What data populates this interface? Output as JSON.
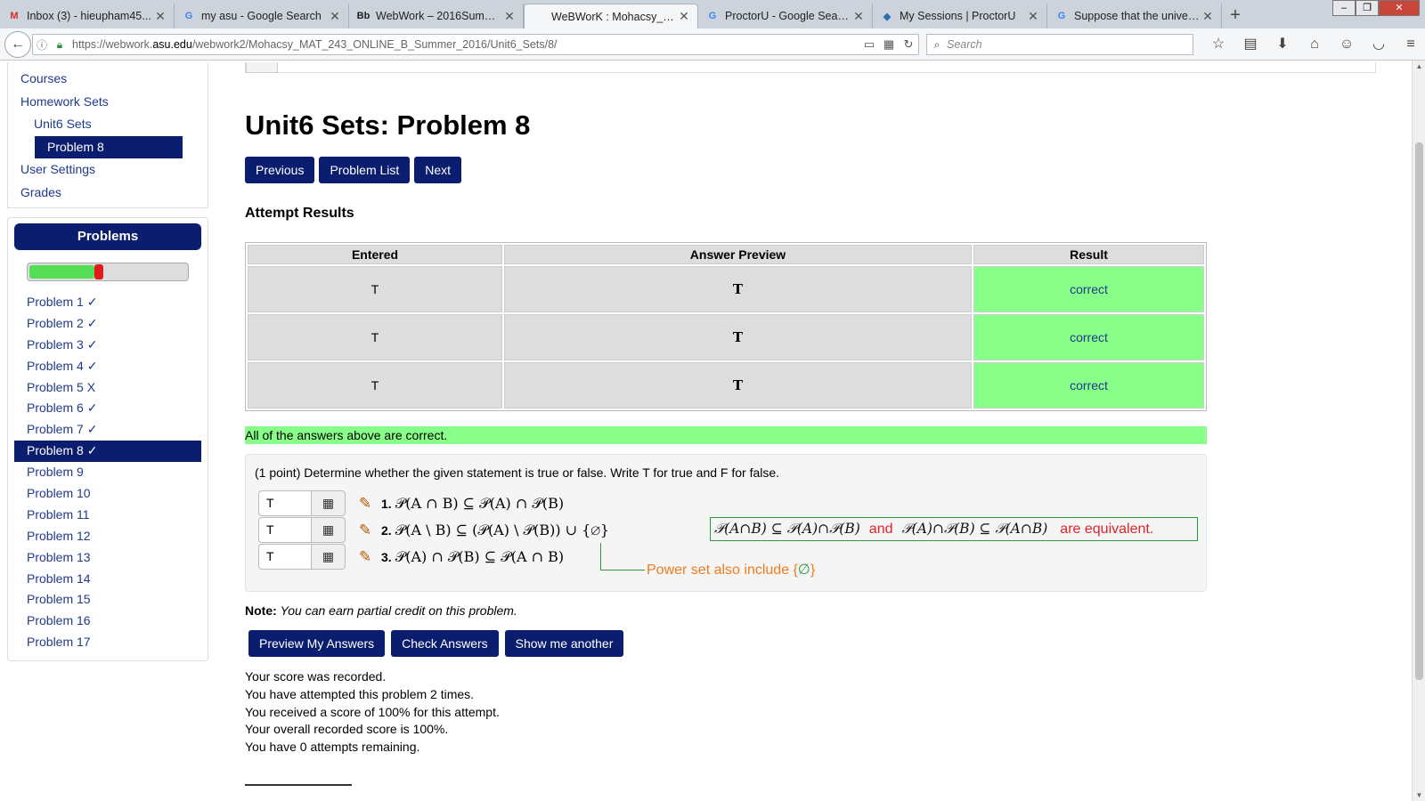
{
  "browser": {
    "tabs": [
      {
        "title": "Inbox (3) - hieupham45...",
        "icon": "gmail-icon",
        "icon_glyph": "M",
        "icon_color": "#d93025"
      },
      {
        "title": "my asu - Google Search",
        "icon": "google-icon",
        "icon_glyph": "G",
        "icon_color": "#4285f4"
      },
      {
        "title": "WebWork – 2016Summer...",
        "icon": "blackboard-icon",
        "icon_glyph": "Bb",
        "icon_color": "#222222"
      },
      {
        "title": "WeBWorK : Mohacsy_M...",
        "icon": "none",
        "icon_glyph": "",
        "icon_color": "#222222"
      },
      {
        "title": "ProctorU - Google Search",
        "icon": "google-icon",
        "icon_glyph": "G",
        "icon_color": "#4285f4"
      },
      {
        "title": "My Sessions | ProctorU",
        "icon": "proctoru-icon",
        "icon_glyph": "◆",
        "icon_color": "#2a6fb3"
      },
      {
        "title": "Suppose that the univers...",
        "icon": "google-icon",
        "icon_glyph": "G",
        "icon_color": "#4285f4"
      }
    ],
    "active_tab": 3,
    "url_prefix": "https://webwork.",
    "url_domain": "asu.edu",
    "url_rest": "/webwork2/Mohacsy_MAT_243_ONLINE_B_Summer_2016/Unit6_Sets/8/",
    "search_placeholder": "Search"
  },
  "sidebar": {
    "nav": [
      {
        "label": "Courses",
        "level": "top"
      },
      {
        "label": "Homework Sets",
        "level": "top"
      },
      {
        "label": "Unit6 Sets",
        "level": "sub"
      },
      {
        "label": "Problem 8",
        "level": "active"
      },
      {
        "label": "User Settings",
        "level": "top"
      },
      {
        "label": "Grades",
        "level": "top"
      }
    ],
    "problems_header": "Problems",
    "progress": {
      "correct_fraction": 0.41,
      "incorrect_fraction": 0.06
    },
    "problems": [
      {
        "label": "Problem 1 ✓"
      },
      {
        "label": "Problem 2 ✓"
      },
      {
        "label": "Problem 3 ✓"
      },
      {
        "label": "Problem 4 ✓"
      },
      {
        "label": "Problem 5 X"
      },
      {
        "label": "Problem 6 ✓"
      },
      {
        "label": "Problem 7 ✓"
      },
      {
        "label": "Problem 8 ✓",
        "active": true
      },
      {
        "label": "Problem 9"
      },
      {
        "label": "Problem 10"
      },
      {
        "label": "Problem 11"
      },
      {
        "label": "Problem 12"
      },
      {
        "label": "Problem 13"
      },
      {
        "label": "Problem 14"
      },
      {
        "label": "Problem 15"
      },
      {
        "label": "Problem 16"
      },
      {
        "label": "Problem 17"
      }
    ]
  },
  "main": {
    "title": "Unit6 Sets: Problem 8",
    "nav_buttons": [
      "Previous",
      "Problem List",
      "Next"
    ],
    "results_heading": "Attempt Results",
    "table_headers": [
      "Entered",
      "Answer Preview",
      "Result"
    ],
    "rows": [
      {
        "entered": "T",
        "preview": "T",
        "result": "correct"
      },
      {
        "entered": "T",
        "preview": "T",
        "result": "correct"
      },
      {
        "entered": "T",
        "preview": "T",
        "result": "correct"
      }
    ],
    "summary": "All of the answers above are correct.",
    "problem_statement": "(1 point) Determine whether the given statement is true or false. Write T for true and F for false.",
    "answers": [
      {
        "value": "T",
        "number": "1.",
        "statement": "𝒫(A ∩ B) ⊆ 𝒫(A) ∩ 𝒫(B)"
      },
      {
        "value": "T",
        "number": "2.",
        "statement": "𝒫(A \\ B) ⊆ (𝒫(A) \\ 𝒫(B)) ∪ {∅}"
      },
      {
        "value": "T",
        "number": "3.",
        "statement": "𝒫(A) ∩ 𝒫(B) ⊆ 𝒫(A ∩ B)"
      }
    ],
    "note_label": "Note:",
    "note_text": "You can earn partial credit on this problem.",
    "action_buttons": [
      "Preview My Answers",
      "Check Answers",
      "Show me another"
    ],
    "score_lines": [
      "Your score was recorded.",
      "You have attempted this problem 2 times.",
      "You received a score of 100% for this attempt.",
      "Your overall recorded score is 100%.",
      "You have 0 attempts remaining."
    ]
  },
  "annotations": {
    "equiv_left": "𝒫(A∩B) ⊆ 𝒫(A)∩𝒫(B)",
    "equiv_and": "and",
    "equiv_right": "𝒫(A)∩𝒫(B) ⊆ 𝒫(A∩B)",
    "equiv_tail": "are equivalent.",
    "powerset_note": "Power set also include {",
    "powerset_symbol": "∅",
    "powerset_close": "}",
    "colors": {
      "green": "#2e9a3e",
      "red": "#e0222a",
      "orange": "#f07c1e"
    }
  }
}
